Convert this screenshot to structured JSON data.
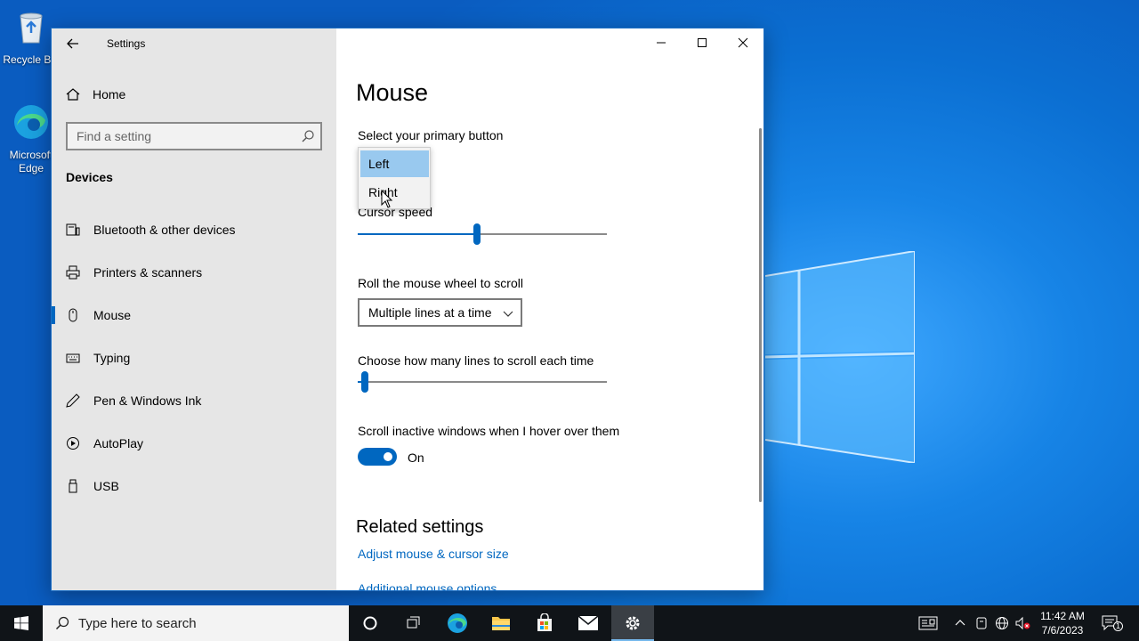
{
  "desktop": {
    "icons": [
      {
        "label": "Recycle Bin"
      },
      {
        "label": "Microsoft Edge"
      }
    ]
  },
  "window": {
    "title": "Settings",
    "controls": {
      "minimize": "minimize-icon",
      "maximize": "maximize-icon",
      "close": "close-icon"
    }
  },
  "sidebar": {
    "home": "Home",
    "search_placeholder": "Find a setting",
    "section": "Devices",
    "items": [
      {
        "label": "Bluetooth & other devices",
        "icon": "bluetooth-devices-icon"
      },
      {
        "label": "Printers & scanners",
        "icon": "printer-icon"
      },
      {
        "label": "Mouse",
        "icon": "mouse-icon",
        "active": true
      },
      {
        "label": "Typing",
        "icon": "keyboard-icon"
      },
      {
        "label": "Pen & Windows Ink",
        "icon": "pen-icon"
      },
      {
        "label": "AutoPlay",
        "icon": "autoplay-icon"
      },
      {
        "label": "USB",
        "icon": "usb-icon"
      }
    ]
  },
  "main": {
    "title": "Mouse",
    "primary_button_label": "Select your primary button",
    "primary_button_options": [
      "Left",
      "Right"
    ],
    "primary_button_selected": "Left",
    "cursor_speed_label": "Cursor speed",
    "cursor_speed_value": 0.48,
    "wheel_label": "Roll the mouse wheel to scroll",
    "wheel_value": "Multiple lines at a time",
    "lines_label": "Choose how many lines to scroll each time",
    "lines_value": 0.03,
    "inactive_label": "Scroll inactive windows when I hover over them",
    "inactive_state": "On",
    "related_title": "Related settings",
    "related_links": [
      "Adjust mouse & cursor size",
      "Additional mouse options"
    ]
  },
  "taskbar": {
    "search_placeholder": "Type here to search",
    "apps": [
      "cortana-icon",
      "task-view-icon",
      "edge-icon",
      "file-explorer-icon",
      "store-icon",
      "mail-icon",
      "settings-icon"
    ],
    "time": "11:42 AM",
    "date": "7/6/2023",
    "notification_count": "1"
  },
  "colors": {
    "accent": "#0067c0",
    "selection": "#99c9ef",
    "taskbar": "#101418"
  }
}
